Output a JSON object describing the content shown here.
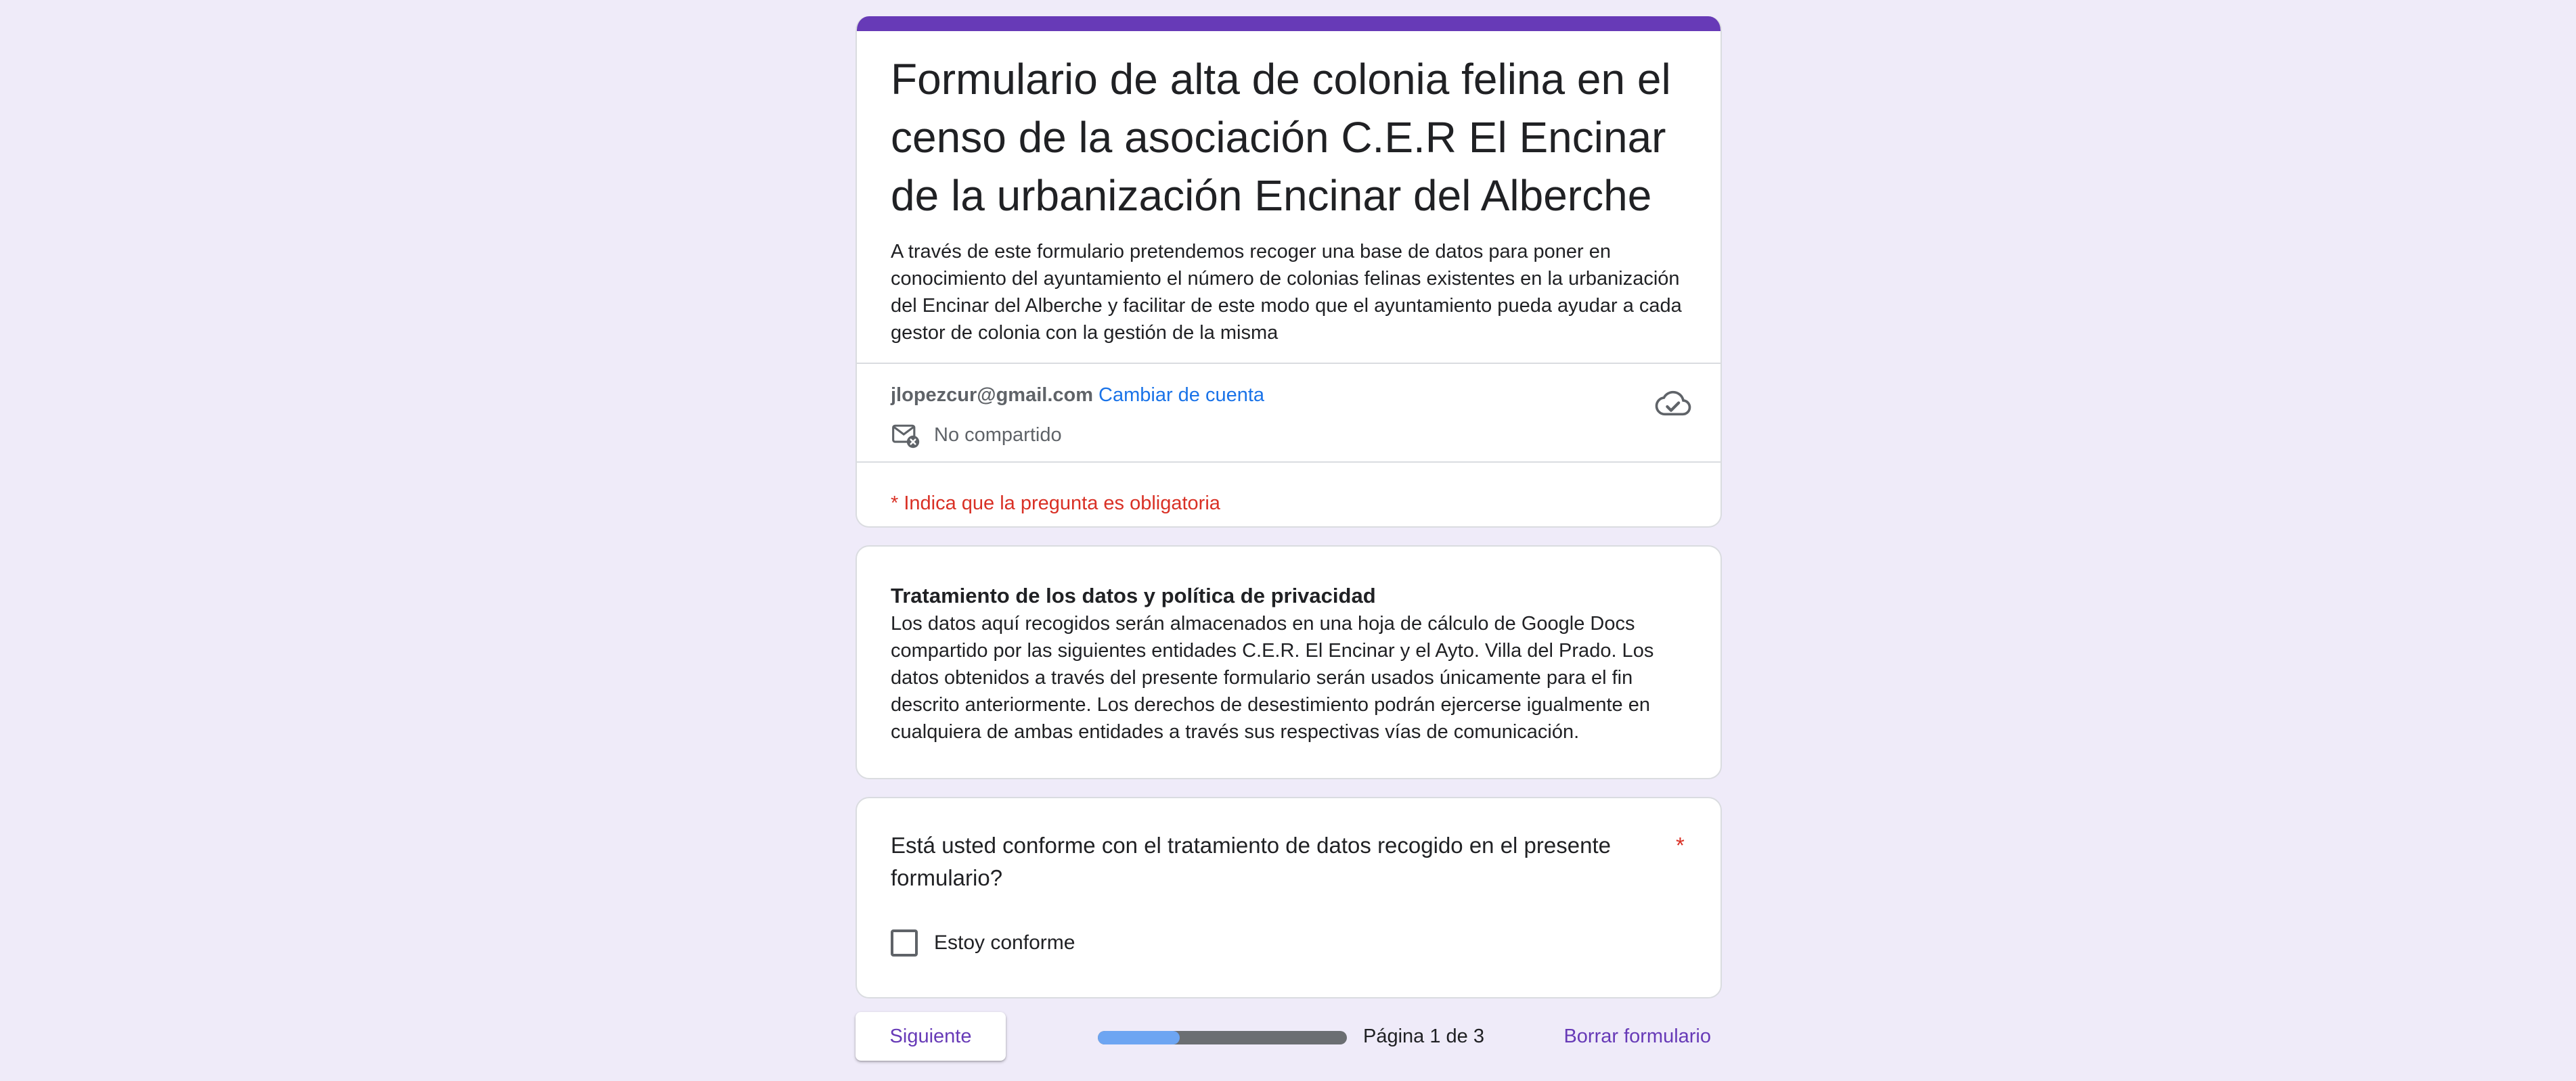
{
  "header": {
    "title": "Formulario de alta de colonia felina en el censo de la asociación C.E.R El Encinar de la urbanización Encinar del Alberche",
    "description": "A través de este formulario pretendemos recoger una base de datos para poner en conocimiento del ayuntamiento el número de colonias felinas existentes en la urbanización del Encinar del Alberche y facilitar de este modo que el ayuntamiento pueda ayudar a cada gestor de colonia con la gestión de la misma",
    "account_email": "jlopezcur@gmail.com",
    "switch_account_label": "Cambiar de cuenta",
    "not_shared_label": "No compartido",
    "required_note": "* Indica que la pregunta es obligatoria"
  },
  "privacy_section": {
    "title": "Tratamiento de los datos y política de privacidad",
    "body": "Los datos aquí recogidos serán almacenados en una hoja de cálculo de Google Docs compartido por las siguientes entidades C.E.R. El Encinar y el Ayto. Villa del Prado. Los datos obtenidos a través del presente formulario serán usados únicamente para el fin descrito anteriormente. Los derechos de desestimiento podrán ejercerse igualmente en cualquiera de ambas entidades a través sus respectivas vías de comunicación."
  },
  "question": {
    "title": "Está usted conforme con el tratamiento de datos recogido en el presente formulario?",
    "required_mark": "*",
    "option_label": "Estoy conforme",
    "checked": false
  },
  "footer": {
    "next_label": "Siguiente",
    "page_text": "Página 1 de 3",
    "progress_percent": 33,
    "clear_label": "Borrar formulario"
  },
  "colors": {
    "accent": "#673ab7",
    "background": "#efebf9",
    "link": "#1a73e8",
    "required": "#d93025",
    "progress_fill": "#6da5f2",
    "progress_track": "#6b6e72"
  },
  "icons": {
    "cloud": "cloud-done-icon",
    "mail": "mail-not-shared-icon"
  }
}
